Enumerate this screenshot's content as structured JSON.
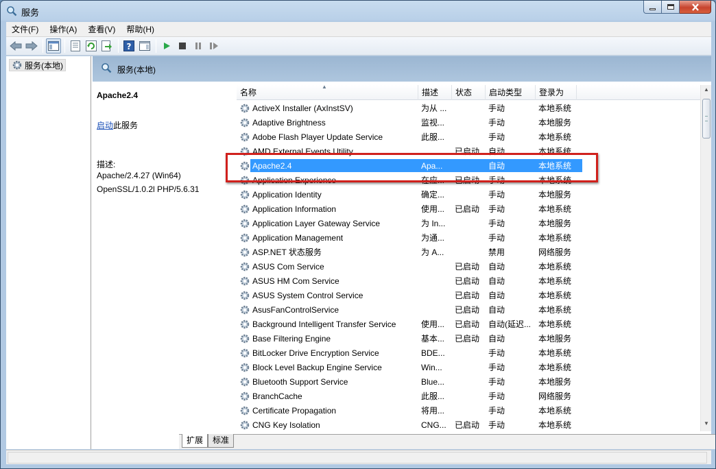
{
  "window": {
    "title": "服务"
  },
  "menu": [
    {
      "label": "文件(F)"
    },
    {
      "label": "操作(A)"
    },
    {
      "label": "查看(V)"
    },
    {
      "label": "帮助(H)"
    }
  ],
  "toolbar_icons": [
    "back-icon",
    "forward-icon",
    "show-hide-tree-icon",
    "properties-icon",
    "refresh-icon",
    "export-icon",
    "help-icon",
    "show-hide-action-pane-icon",
    "start-icon",
    "stop-icon",
    "pause-icon",
    "restart-icon"
  ],
  "tree": {
    "root_label": "服务(本地)"
  },
  "header": {
    "label": "服务(本地)"
  },
  "extended": {
    "service_name": "Apache2.4",
    "start_link": "启动",
    "start_suffix": "此服务",
    "desc_label": "描述:",
    "desc_line1": "Apache/2.4.27 (Win64)",
    "desc_line2": "OpenSSL/1.0.2l PHP/5.6.31"
  },
  "columns": {
    "name": "名称",
    "desc": "描述",
    "status": "状态",
    "startup": "启动类型",
    "logon": "登录为"
  },
  "services": [
    {
      "name": "ActiveX Installer (AxInstSV)",
      "desc": "为从 ...",
      "status": "",
      "startup": "手动",
      "logon": "本地系统"
    },
    {
      "name": "Adaptive Brightness",
      "desc": "监视...",
      "status": "",
      "startup": "手动",
      "logon": "本地服务"
    },
    {
      "name": "Adobe Flash Player Update Service",
      "desc": "此服...",
      "status": "",
      "startup": "手动",
      "logon": "本地系统"
    },
    {
      "name": "AMD External Events Utility",
      "desc": "",
      "status": "已启动",
      "startup": "自动",
      "logon": "本地系统"
    },
    {
      "name": "Apache2.4",
      "desc": "Apa...",
      "status": "",
      "startup": "自动",
      "logon": "本地系统",
      "selected": true
    },
    {
      "name": "Application Experience",
      "desc": "在应...",
      "status": "已启动",
      "startup": "手动",
      "logon": "本地系统"
    },
    {
      "name": "Application Identity",
      "desc": "确定...",
      "status": "",
      "startup": "手动",
      "logon": "本地服务"
    },
    {
      "name": "Application Information",
      "desc": "使用...",
      "status": "已启动",
      "startup": "手动",
      "logon": "本地系统"
    },
    {
      "name": "Application Layer Gateway Service",
      "desc": "为 In...",
      "status": "",
      "startup": "手动",
      "logon": "本地服务"
    },
    {
      "name": "Application Management",
      "desc": "为通...",
      "status": "",
      "startup": "手动",
      "logon": "本地系统"
    },
    {
      "name": "ASP.NET 状态服务",
      "desc": "为 A...",
      "status": "",
      "startup": "禁用",
      "logon": "网络服务"
    },
    {
      "name": "ASUS Com Service",
      "desc": "",
      "status": "已启动",
      "startup": "自动",
      "logon": "本地系统"
    },
    {
      "name": "ASUS HM Com Service",
      "desc": "",
      "status": "已启动",
      "startup": "自动",
      "logon": "本地系统"
    },
    {
      "name": "ASUS System Control Service",
      "desc": "",
      "status": "已启动",
      "startup": "自动",
      "logon": "本地系统"
    },
    {
      "name": "AsusFanControlService",
      "desc": "",
      "status": "已启动",
      "startup": "自动",
      "logon": "本地系统"
    },
    {
      "name": "Background Intelligent Transfer Service",
      "desc": "使用...",
      "status": "已启动",
      "startup": "自动(延迟...",
      "logon": "本地系统"
    },
    {
      "name": "Base Filtering Engine",
      "desc": "基本...",
      "status": "已启动",
      "startup": "自动",
      "logon": "本地服务"
    },
    {
      "name": "BitLocker Drive Encryption Service",
      "desc": "BDE...",
      "status": "",
      "startup": "手动",
      "logon": "本地系统"
    },
    {
      "name": "Block Level Backup Engine Service",
      "desc": "Win...",
      "status": "",
      "startup": "手动",
      "logon": "本地系统"
    },
    {
      "name": "Bluetooth Support Service",
      "desc": "Blue...",
      "status": "",
      "startup": "手动",
      "logon": "本地服务"
    },
    {
      "name": "BranchCache",
      "desc": "此服...",
      "status": "",
      "startup": "手动",
      "logon": "网络服务"
    },
    {
      "name": "Certificate Propagation",
      "desc": "将用...",
      "status": "",
      "startup": "手动",
      "logon": "本地系统"
    },
    {
      "name": "CNG Key Isolation",
      "desc": "CNG...",
      "status": "已启动",
      "startup": "手动",
      "logon": "本地系统"
    }
  ],
  "tabs": [
    {
      "label": "扩展"
    },
    {
      "label": "标准"
    }
  ],
  "colors": {
    "selection": "#3399ff",
    "highlight_box": "#d0201c",
    "link": "#1a4fb7"
  }
}
